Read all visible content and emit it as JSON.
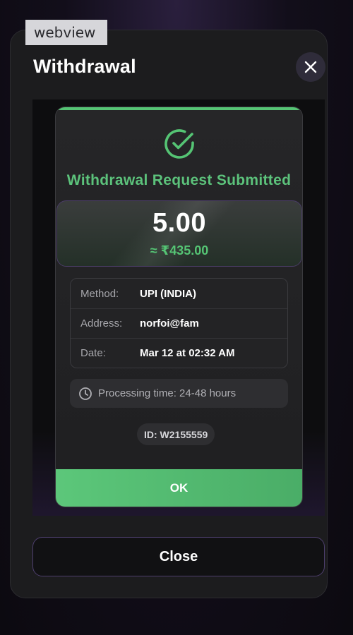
{
  "overlay_tag": "webview",
  "modal": {
    "title": "Withdrawal",
    "close_button_label": "Close"
  },
  "receipt": {
    "heading": "Withdrawal Request Submitted",
    "amount": "5.00",
    "fiat_amount": "≈ ₹435.00",
    "details": [
      {
        "label": "Method:",
        "value": "UPI (INDIA)"
      },
      {
        "label": "Address:",
        "value": "norfoi@fam"
      },
      {
        "label": "Date:",
        "value": "Mar 12 at 02:32 AM"
      }
    ],
    "processing_text": "Processing time: 24-48 hours",
    "transaction_id": "ID: W2155559",
    "ok_label": "OK"
  },
  "icons": {
    "success": "check-circle-icon",
    "close": "close-icon",
    "clock": "clock-icon"
  },
  "colors": {
    "accent_green": "#55c474",
    "modal_bg": "#1c1c1e",
    "border_purple": "#4e3f6e"
  }
}
